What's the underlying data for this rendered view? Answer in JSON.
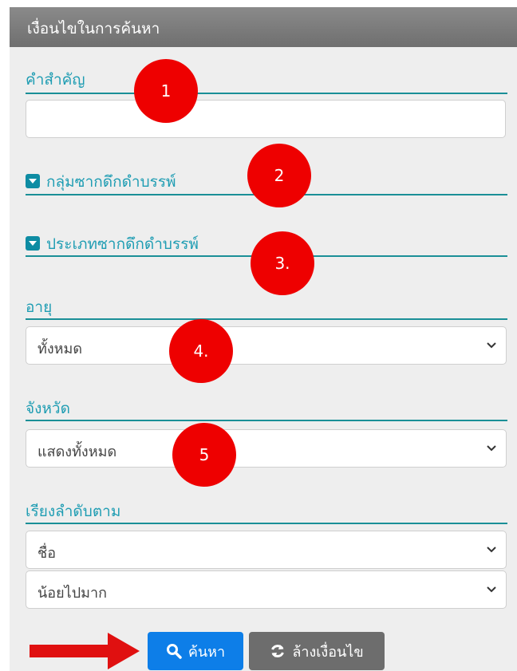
{
  "header": {
    "title": "เงื่อนไขในการค้นหา"
  },
  "keyword": {
    "label": "คำสำคัญ",
    "value": "",
    "placeholder": ""
  },
  "group": {
    "label": "กลุ่มซากดึกดำบรรพ์",
    "icon": "caret-down-square-icon"
  },
  "type": {
    "label": "ประเภทซากดึกดำบรรพ์",
    "icon": "caret-down-square-icon"
  },
  "age": {
    "label": "อายุ",
    "selected": "ทั้งหมด"
  },
  "province": {
    "label": "จังหวัด",
    "selected": "แสดงทั้งหมด"
  },
  "sort": {
    "label": "เรียงลำดับตาม",
    "field": "ชื่อ",
    "order": "น้อยไปมาก"
  },
  "buttons": {
    "search": "ค้นหา",
    "clear": "ล้างเงื่อนไข"
  },
  "annotations": [
    "1",
    "2",
    "3.",
    "4.",
    "5"
  ],
  "colors": {
    "accent": "#1a8f97",
    "badge": "#ee0000",
    "search_button": "#0d7ee8",
    "clear_button": "#6d6d6d",
    "arrow": "#e01010"
  }
}
